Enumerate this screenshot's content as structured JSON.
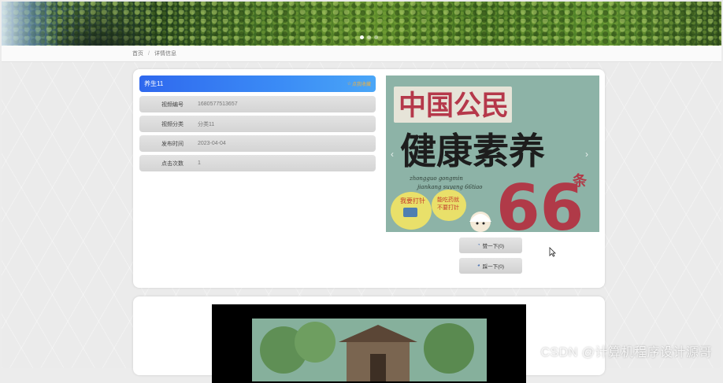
{
  "banner": {
    "slides": 3,
    "active_slide": 1
  },
  "breadcrumb": {
    "home": "首页",
    "separator": "/",
    "current": "详情信息"
  },
  "detail": {
    "title": "养生11",
    "favorite_label": "点我收藏",
    "fields": [
      {
        "label": "视频编号",
        "value": "1680577513657"
      },
      {
        "label": "视频分类",
        "value": "分类11"
      },
      {
        "label": "发布时间",
        "value": "2023-04-04"
      },
      {
        "label": "点击次数",
        "value": "1"
      }
    ]
  },
  "cover": {
    "line1": "中国公民",
    "line2": "健康素养",
    "number": "66",
    "suffix": "条",
    "pinyin1": "zhongguo gongmin",
    "pinyin2": "jiankang suyang 66tiao",
    "bubble1a": "我要打针",
    "bubble2a": "能吃药就",
    "bubble2b": "不要打针"
  },
  "actions": {
    "like": "赞一下(0)",
    "dislike": "踩一下(0)"
  },
  "watermark": "CSDN @计算机程序设计源哥",
  "colors": {
    "title_gradient_start": "#2f68ee",
    "title_gradient_end": "#4aa6f7",
    "favorite": "#f2b03b",
    "number_red": "#b03a48"
  }
}
